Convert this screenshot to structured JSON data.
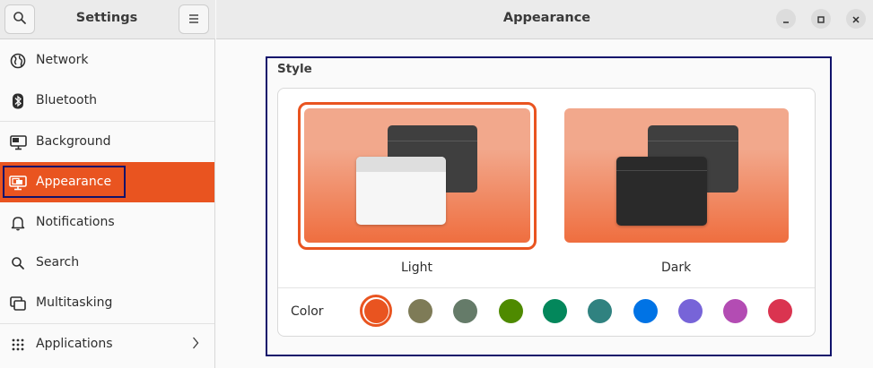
{
  "sidebar": {
    "title": "Settings",
    "items": [
      {
        "label": "Network",
        "icon": "network-globe-icon"
      },
      {
        "label": "Bluetooth",
        "icon": "bluetooth-icon"
      },
      {
        "label": "Background",
        "icon": "background-monitor-icon"
      },
      {
        "label": "Appearance",
        "icon": "appearance-icon",
        "active": true
      },
      {
        "label": "Notifications",
        "icon": "bell-icon"
      },
      {
        "label": "Search",
        "icon": "search-icon"
      },
      {
        "label": "Multitasking",
        "icon": "multitasking-icon"
      },
      {
        "label": "Applications",
        "icon": "apps-grid-icon"
      }
    ]
  },
  "header": {
    "title": "Appearance"
  },
  "style_section": {
    "label": "Style",
    "themes": [
      {
        "label": "Light",
        "selected": true
      },
      {
        "label": "Dark",
        "selected": false
      }
    ],
    "color_label": "Color",
    "colors": [
      "#e95420",
      "#7e7b57",
      "#657b69",
      "#4e8a00",
      "#03875b",
      "#308280",
      "#0073e5",
      "#7764d8",
      "#b34cb3",
      "#da3450"
    ],
    "selected_color": "#e95420"
  },
  "accent_color": "#e95420"
}
